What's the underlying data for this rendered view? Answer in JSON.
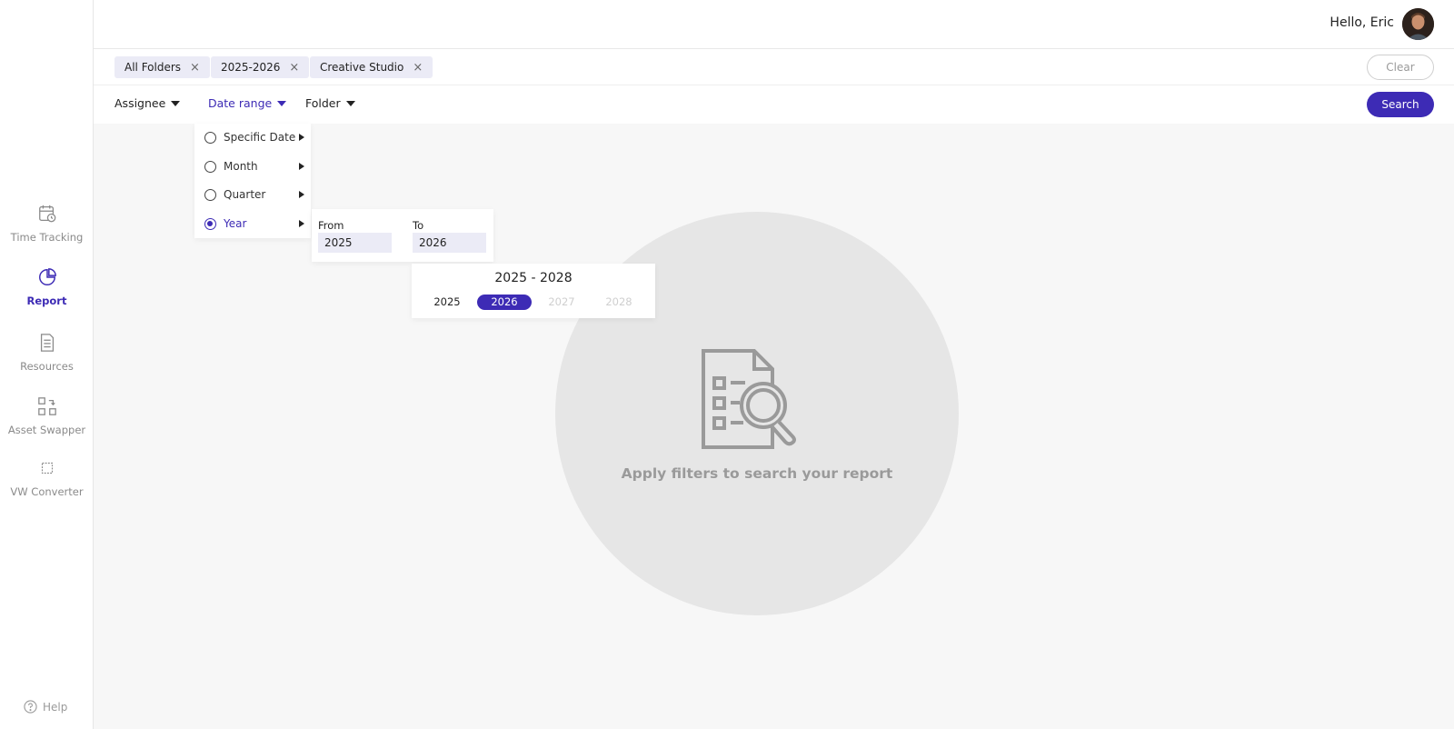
{
  "header": {
    "greeting": "Hello, Eric"
  },
  "sidebar": {
    "items": [
      {
        "label": "Time Tracking",
        "icon": "calendar-clock-icon",
        "active": false
      },
      {
        "label": "Report",
        "icon": "pie-chart-icon",
        "active": true
      },
      {
        "label": "Resources",
        "icon": "document-icon",
        "active": false
      },
      {
        "label": "Asset Swapper",
        "icon": "swap-icon",
        "active": false
      },
      {
        "label": "VW Converter",
        "icon": "converter-icon",
        "active": false
      }
    ],
    "help": "Help"
  },
  "chips": [
    {
      "label": "All Folders",
      "close": "×"
    },
    {
      "label": "2025-2026",
      "close": "×"
    },
    {
      "label": "Creative Studio",
      "close": "×"
    }
  ],
  "clear_label": "Clear",
  "filters": {
    "assignee": "Assignee",
    "date_range": "Date range",
    "folder": "Folder"
  },
  "search_label": "Search",
  "date_menu": {
    "options": [
      "Specific Date",
      "Month",
      "Quarter",
      "Year"
    ],
    "selected": "Year"
  },
  "year_range": {
    "from_label": "From",
    "from_value": "2025",
    "to_label": "To",
    "to_value": "2026"
  },
  "year_picker": {
    "title": "2025 - 2028",
    "years": [
      {
        "label": "2025",
        "state": "normal"
      },
      {
        "label": "2026",
        "state": "selected"
      },
      {
        "label": "2027",
        "state": "disabled"
      },
      {
        "label": "2028",
        "state": "disabled"
      }
    ]
  },
  "empty_state": {
    "message": "Apply filters to search your report"
  },
  "colors": {
    "accent": "#3d2bb5",
    "chip_bg": "#ebebf6",
    "canvas_bg": "#f7f7f7",
    "circle_bg": "#e6e6e6"
  }
}
